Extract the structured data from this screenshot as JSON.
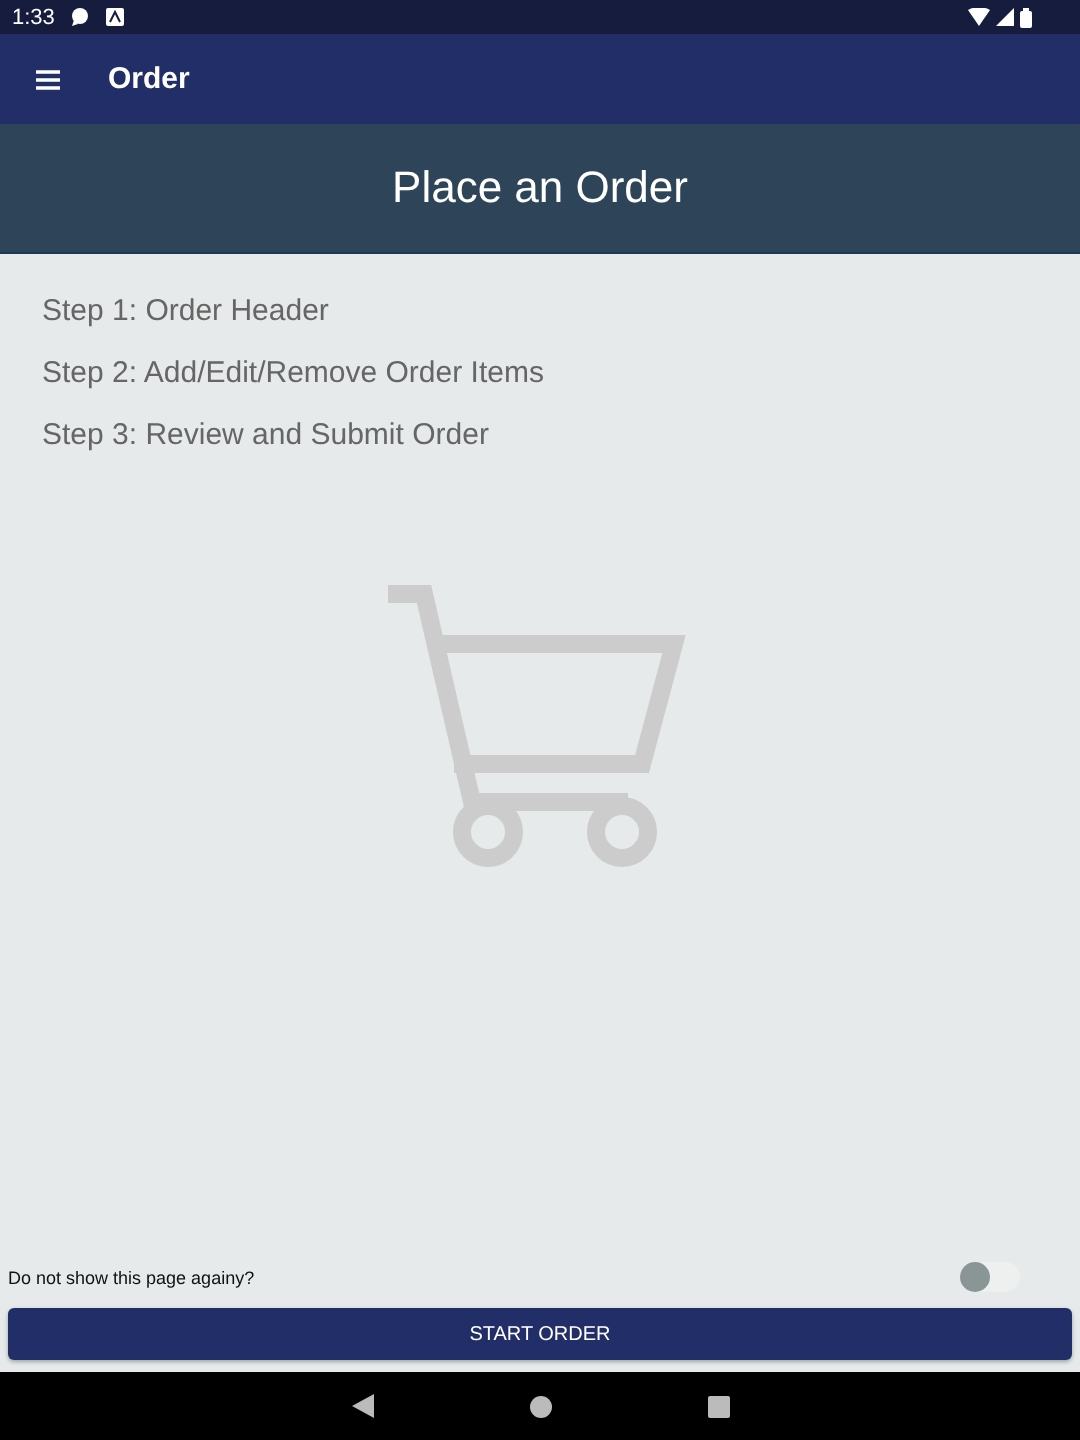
{
  "status_bar": {
    "time": "1:33"
  },
  "app_bar": {
    "title": "Order"
  },
  "header": {
    "title": "Place an Order"
  },
  "steps": [
    "Step 1: Order Header",
    "Step 2: Add/Edit/Remove Order Items",
    "Step 3: Review and Submit Order"
  ],
  "dont_show": {
    "label": "Do not show this page againy?",
    "on": false
  },
  "start_button": {
    "label": "START ORDER"
  }
}
